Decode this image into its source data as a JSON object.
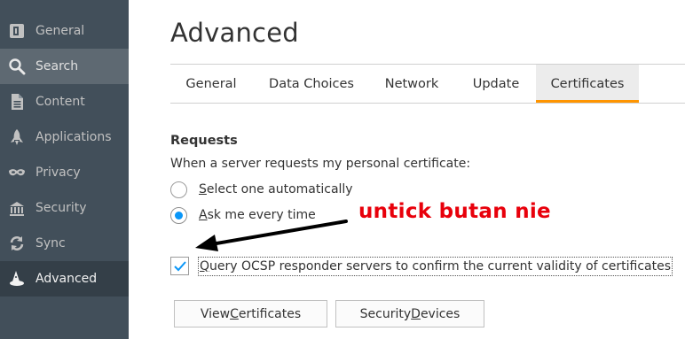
{
  "sidebar": {
    "items": [
      {
        "label": "General",
        "icon": "general-icon"
      },
      {
        "label": "Search",
        "icon": "search-icon"
      },
      {
        "label": "Content",
        "icon": "content-icon"
      },
      {
        "label": "Applications",
        "icon": "applications-icon"
      },
      {
        "label": "Privacy",
        "icon": "privacy-mask-icon"
      },
      {
        "label": "Security",
        "icon": "security-icon"
      },
      {
        "label": "Sync",
        "icon": "sync-icon"
      },
      {
        "label": "Advanced",
        "icon": "advanced-wizard-hat-icon"
      }
    ],
    "hover_item": "Search",
    "selected_item": "Advanced"
  },
  "main": {
    "title": "Advanced",
    "tabs": [
      {
        "label": "General"
      },
      {
        "label": "Data Choices"
      },
      {
        "label": "Network"
      },
      {
        "label": "Update"
      },
      {
        "label": "Certificates"
      }
    ],
    "selected_tab": "Certificates"
  },
  "requests": {
    "heading": "Requests",
    "description": "When a server requests my personal certificate:",
    "option_auto": {
      "accesskey": "S",
      "rest": "elect one automatically",
      "checked": false
    },
    "option_ask": {
      "accesskey": "A",
      "rest": "sk me every time",
      "checked": true
    }
  },
  "ocsp": {
    "accesskey": "Q",
    "rest": "uery OCSP responder servers to confirm the current validity of certificates",
    "checked": true
  },
  "buttons": {
    "view_certs": {
      "pre": "View ",
      "accesskey": "C",
      "post": "ertificates"
    },
    "security_devices": {
      "pre": "Security ",
      "accesskey": "D",
      "post": "evices"
    }
  },
  "annotation": {
    "text": "untick butan nie",
    "color": "#e8000b"
  },
  "colors": {
    "sidebar_bg": "#424f5a",
    "accent_tab": "#ff9500",
    "radio_accent": "#0996f8"
  }
}
